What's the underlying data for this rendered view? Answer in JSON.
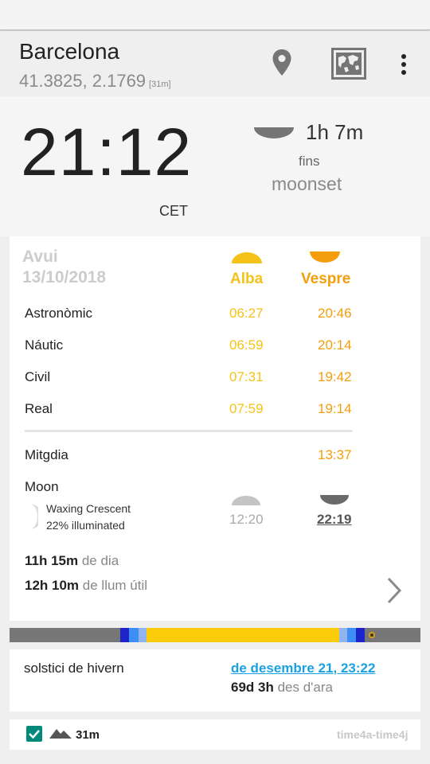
{
  "location": {
    "name": "Barcelona",
    "coords": "41.3825, 2.1769",
    "elevation_tag": "[31m]"
  },
  "appbar": {
    "icons": [
      "map-pin-icon",
      "world-map-icon",
      "more-vert-icon"
    ]
  },
  "clock": {
    "time": "21:12",
    "timezone": "CET"
  },
  "moon_next": {
    "duration": "1h 7m",
    "until": "fins",
    "event": "moonset"
  },
  "today": {
    "label": "Avui",
    "date": "13/10/2018",
    "dawn_header": "Alba",
    "dusk_header": "Vespre",
    "rows": [
      {
        "label": "Astronòmic",
        "dawn": "06:27",
        "dusk": "20:46"
      },
      {
        "label": "Náutic",
        "dawn": "06:59",
        "dusk": "20:14"
      },
      {
        "label": "Civil",
        "dawn": "07:31",
        "dusk": "19:42"
      },
      {
        "label": "Real",
        "dawn": "07:59",
        "dusk": "19:14"
      }
    ],
    "noon_label": "Mitgdia",
    "noon_time": "13:37",
    "moon_label": "Moon",
    "moon_phase": "Waxing Crescent",
    "moon_illum": "22% illuminated",
    "moonrise": "12:20",
    "moonset": "22:19",
    "daylength_value": "11h 15m",
    "daylength_text": "de dia",
    "lightlength_value": "12h 10m",
    "lightlength_text": "de llum útil"
  },
  "colors": {
    "dawn": "#f5c21a",
    "dusk": "#f59e0b",
    "link": "#1ba1e2",
    "accent": "#00897b"
  },
  "solstice": {
    "name": "solstici de hivern",
    "date_link": "de desembre 21, 23:22",
    "countdown_value": "69d 3h",
    "countdown_text": "des d'ara"
  },
  "footer": {
    "elevation": "31m",
    "source": "time4a-time4j",
    "checkbox_checked": true
  }
}
